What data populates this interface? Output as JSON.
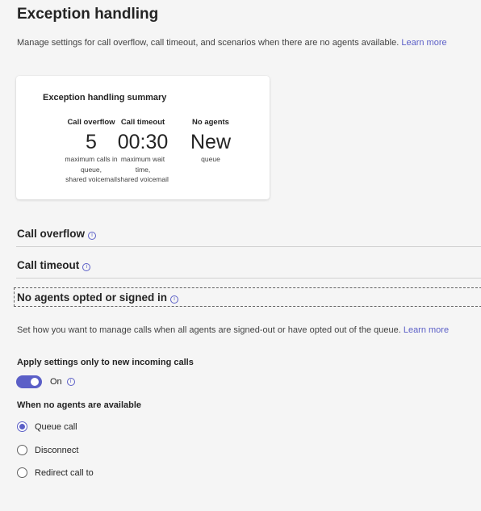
{
  "page": {
    "title": "Exception handling",
    "description": "Manage settings for call overflow, call timeout, and scenarios when there are no agents available.",
    "learn_more": "Learn more"
  },
  "summary": {
    "title": "Exception handling summary",
    "columns": [
      {
        "heading": "Call overflow",
        "value": "5",
        "note_lines": [
          "maximum calls in",
          "queue,",
          "shared voicemail"
        ]
      },
      {
        "heading": "Call timeout",
        "value": "00:30",
        "note_lines": [
          "maximum wait",
          "time,",
          "shared voicemail"
        ]
      },
      {
        "heading": "No agents",
        "value": "New",
        "note_lines": [
          "queue"
        ]
      }
    ]
  },
  "sections": [
    {
      "label": "Call overflow",
      "icon": "info-icon"
    },
    {
      "label": "Call timeout",
      "icon": "info-icon"
    },
    {
      "label": "No agents opted or signed in",
      "icon": "info-icon"
    }
  ],
  "no_agents": {
    "description": "Set how you want to manage calls when all agents are signed-out or have opted out of the queue.",
    "learn_more": "Learn more",
    "apply_heading": "Apply settings only to new incoming calls",
    "toggle_label": "On",
    "toggle_on": true,
    "when_heading": "When no agents are available",
    "options": [
      {
        "label": "Queue call",
        "checked": true
      },
      {
        "label": "Disconnect",
        "checked": false
      },
      {
        "label": "Redirect call to",
        "checked": false
      }
    ]
  },
  "colors": {
    "accent": "#5b5fc7",
    "background": "#f5f5f5",
    "text": "#242424"
  }
}
